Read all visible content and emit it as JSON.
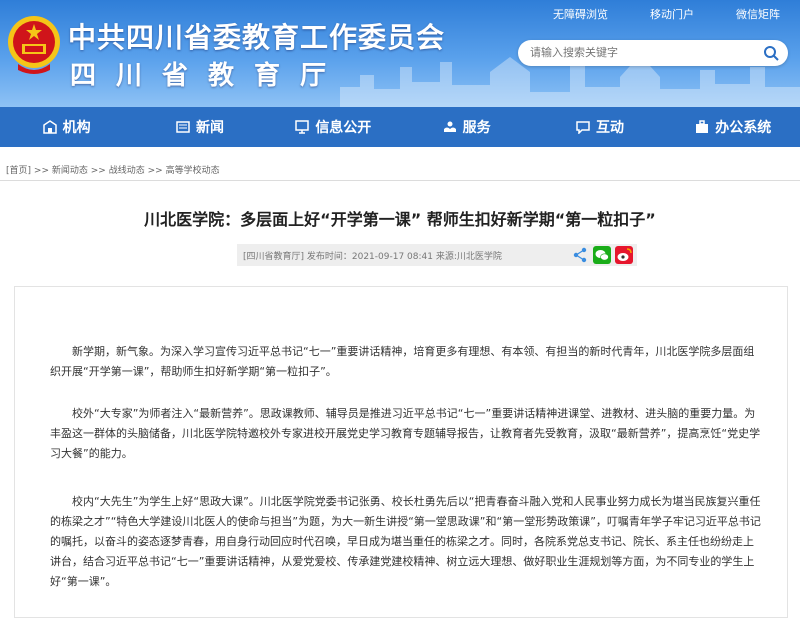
{
  "header": {
    "title": "中共四川省委教育工作委员会",
    "subtitle": "四川省教育厅",
    "top_links": [
      "无障碍浏览",
      "移动门户",
      "微信矩阵"
    ],
    "search_placeholder": "请输入搜索关键字"
  },
  "nav": {
    "items": [
      {
        "label": "机构",
        "icon": "building-icon"
      },
      {
        "label": "新闻",
        "icon": "newspaper-icon"
      },
      {
        "label": "信息公开",
        "icon": "monitor-icon"
      },
      {
        "label": "服务",
        "icon": "hands-icon"
      },
      {
        "label": "互动",
        "icon": "chat-icon"
      },
      {
        "label": "办公系统",
        "icon": "briefcase-icon"
      }
    ]
  },
  "breadcrumb": {
    "home": "[首页]",
    "sep": ">>",
    "items": [
      "新闻动态",
      "战线动态",
      "高等学校动态"
    ]
  },
  "article": {
    "title": "川北医学院：多层面上好“开学第一课”  帮师生扣好新学期“第一粒扣子”",
    "meta": "[四川省教育厅]   发布时间：2021-09-17 08:41   来源:川北医学院",
    "share_icons": [
      "share-icon",
      "wechat-icon",
      "weibo-icon"
    ],
    "paragraphs": [
      "新学期，新气象。为深入学习宣传习近平总书记“七一”重要讲话精神，培育更多有理想、有本领、有担当的新时代青年，川北医学院多层面组织开展“开学第一课”，帮助师生扣好新学期“第一粒扣子”。",
      "校外“大专家”为师者注入“最新营养”。思政课教师、辅导员是推进习近平总书记“七一”重要讲话精神进课堂、进教材、进头脑的重要力量。为丰盈这一群体的头脑储备，川北医学院特邀校外专家进校开展党史学习教育专题辅导报告，让教育者先受教育，汲取“最新营养”，提高烹饪“党史学习大餐”的能力。",
      "校内“大先生”为学生上好“思政大课”。川北医学院党委书记张勇、校长杜勇先后以“把青春奋斗融入党和人民事业努力成长为堪当民族复兴重任的栋梁之才”“特色大学建设川北医人的使命与担当”为题，为大一新生讲授“第一堂思政课”和“第一堂形势政策课”，叮嘱青年学子牢记习近平总书记的嘱托，以奋斗的姿态逐梦青春，用自身行动回应时代召唤，早日成为堪当重任的栋梁之才。同时，各院系党总支书记、院长、系主任也纷纷走上讲台，结合习近平总书记“七一”重要讲话精神，从爱党爱校、传承建党建校精神、树立远大理想、做好职业生涯规划等方面，为不同专业的学生上好“第一课”。"
    ]
  },
  "colors": {
    "nav_bg": "#2b6fc4",
    "banner_top": "#2f7ed8",
    "emblem_red": "#d0141a",
    "emblem_gold": "#f5c518"
  }
}
